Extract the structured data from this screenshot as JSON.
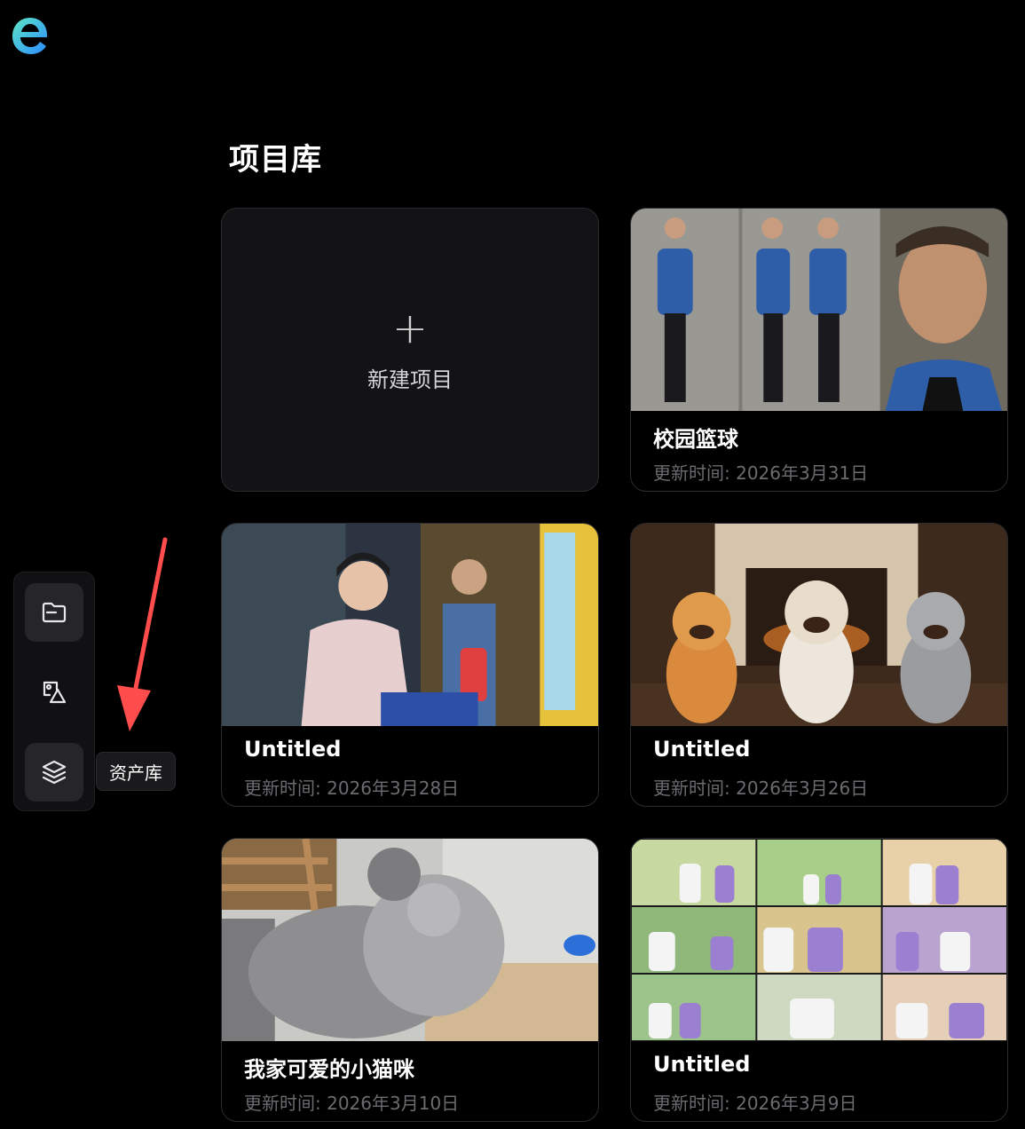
{
  "app": {
    "logo": "app-logo"
  },
  "page": {
    "title": "项目库"
  },
  "sidebar": {
    "items": [
      {
        "name": "projects",
        "icon": "folder-icon",
        "active": true
      },
      {
        "name": "images",
        "icon": "image-shapes-icon",
        "active": false
      },
      {
        "name": "assets",
        "icon": "layers-icon",
        "active": false
      }
    ],
    "tooltip": "资产库"
  },
  "new_project": {
    "plus": "+",
    "label": "新建项目"
  },
  "projects": [
    {
      "title": "校园篮球",
      "date": "更新时间: 2026年3月31日"
    },
    {
      "title": "Untitled",
      "date": "更新时间: 2026年3月28日"
    },
    {
      "title": "Untitled",
      "date": "更新时间: 2026年3月26日"
    },
    {
      "title": "我家可爱的小猫咪",
      "date": "更新时间: 2026年3月10日"
    },
    {
      "title": "Untitled",
      "date": "更新时间: 2026年3月9日"
    }
  ],
  "colors": {
    "accent_arrow": "#ff4d4d",
    "logo_gradient_start": "#5ee7c5",
    "logo_gradient_end": "#2b8cff"
  }
}
